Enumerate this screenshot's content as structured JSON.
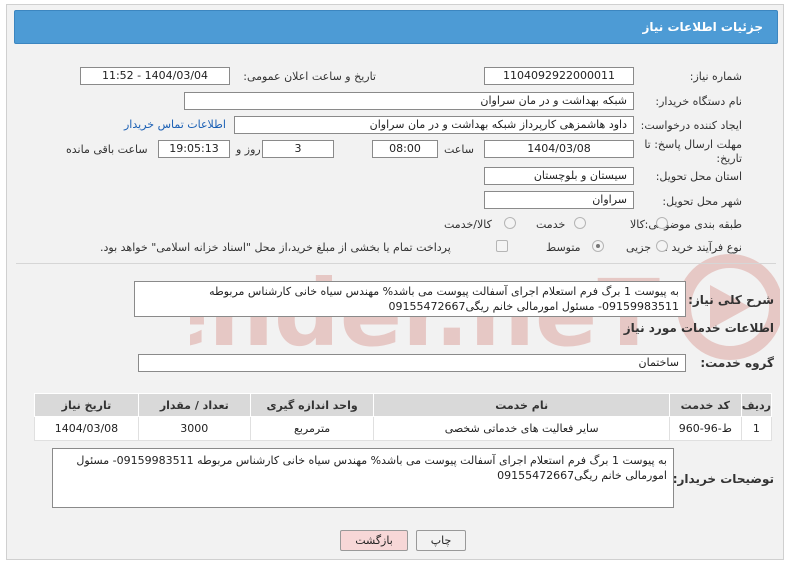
{
  "header": {
    "title": "جزئیات اطلاعات نیاز"
  },
  "fields": {
    "need_number_label": "شماره نیاز:",
    "need_number": "1104092922000011",
    "announce_label": "تاریخ و ساعت اعلان عمومی:",
    "announce_value": "1404/03/04 - 11:52",
    "buyer_org_label": "نام دستگاه خریدار:",
    "buyer_org": "شبکه بهداشت و در مان سراوان",
    "requester_label": "ایجاد کننده درخواست:",
    "requester": "داود هاشمزهی  کارپرداز شبکه بهداشت و در مان سراوان",
    "contact_link": "اطلاعات تماس خریدار",
    "deadline_label_1": "مهلت ارسال پاسخ: تا",
    "deadline_label_2": "تاریخ:",
    "deadline_date": "1404/03/08",
    "hour_label": "ساعت",
    "deadline_time": "08:00",
    "days_value": "3",
    "days_label": "روز و",
    "remaining_time": "19:05:13",
    "remaining_label": "ساعت باقی مانده",
    "province_label": "استان محل تحویل:",
    "province": "سیستان و بلوچستان",
    "city_label": "شهر محل تحویل:",
    "city": "سراوان",
    "category_label": "طبقه بندی موضوعی:",
    "category_options": [
      "کالا",
      "خدمت",
      "کالا/خدمت"
    ],
    "purchase_type_label": "نوع فرآیند خرید :",
    "purchase_type_options": [
      "جزیی",
      "متوسط"
    ],
    "payment_note": "پرداخت تمام یا بخشی از مبلغ خرید،از محل \"اسناد خزانه اسلامی\" خواهد بود."
  },
  "summary": {
    "label": "شرح کلی نیاز:",
    "text": "به پیوست 1 برگ فرم استعلام اجرای آسفالت پیوست می باشد%  مهندس سیاه خانی کارشناس مربوطه 09159983511- مسئول امورمالی خانم ریگی09155472667"
  },
  "services": {
    "section_title": "اطلاعات خدمات مورد نیاز",
    "group_label": "گروه خدمت:",
    "group_value": "ساختمان",
    "columns": [
      "ردیف",
      "کد خدمت",
      "نام خدمت",
      "واحد اندازه گیری",
      "تعداد / مقدار",
      "تاریخ نیاز"
    ],
    "rows": [
      [
        "1",
        "ط-96-960",
        "سایر فعالیت های خدماتی شخصی",
        "مترمربع",
        "3000",
        "1404/03/08"
      ]
    ]
  },
  "buyer_notes": {
    "label": "توضیحات خریدار:",
    "text": "به پیوست 1 برگ فرم استعلام اجرای آسفالت پیوست می باشد%  مهندس سیاه خانی کارشناس مربوطه 09159983511- مسئول امورمالی خانم ریگی09155472667"
  },
  "buttons": {
    "print": "چاپ",
    "back": "بازگشت"
  },
  "colors": {
    "title_bar": "#4d9bd5",
    "link": "#1a5fb4",
    "back_button": "#f7d7d7",
    "watermark": "#c0392b"
  }
}
